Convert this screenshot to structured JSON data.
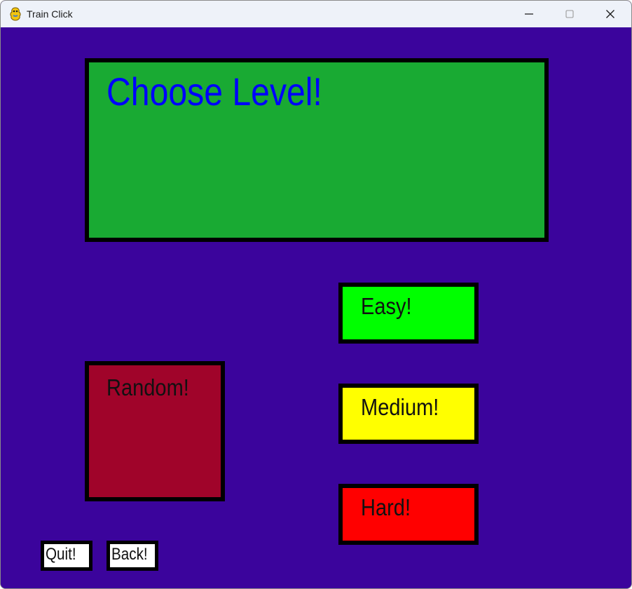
{
  "window": {
    "title": "Train Click",
    "icon": "pygame-snake-icon",
    "controls": {
      "minimize_icon": "minimize-icon",
      "maximize_icon": "maximize-icon",
      "close_icon": "close-icon"
    }
  },
  "game": {
    "background_color": "#3b049c",
    "heading": "Choose Level!",
    "heading_panel_color": "#19aa33",
    "heading_text_color": "#0000ff",
    "levels": {
      "easy": {
        "label": "Easy!",
        "color": "#00ff00"
      },
      "medium": {
        "label": "Medium!",
        "color": "#ffff00"
      },
      "hard": {
        "label": "Hard!",
        "color": "#ff0000"
      },
      "random": {
        "label": "Random!",
        "color": "#a0042a"
      }
    },
    "quit_label": "Quit!",
    "back_label": "Back!"
  }
}
